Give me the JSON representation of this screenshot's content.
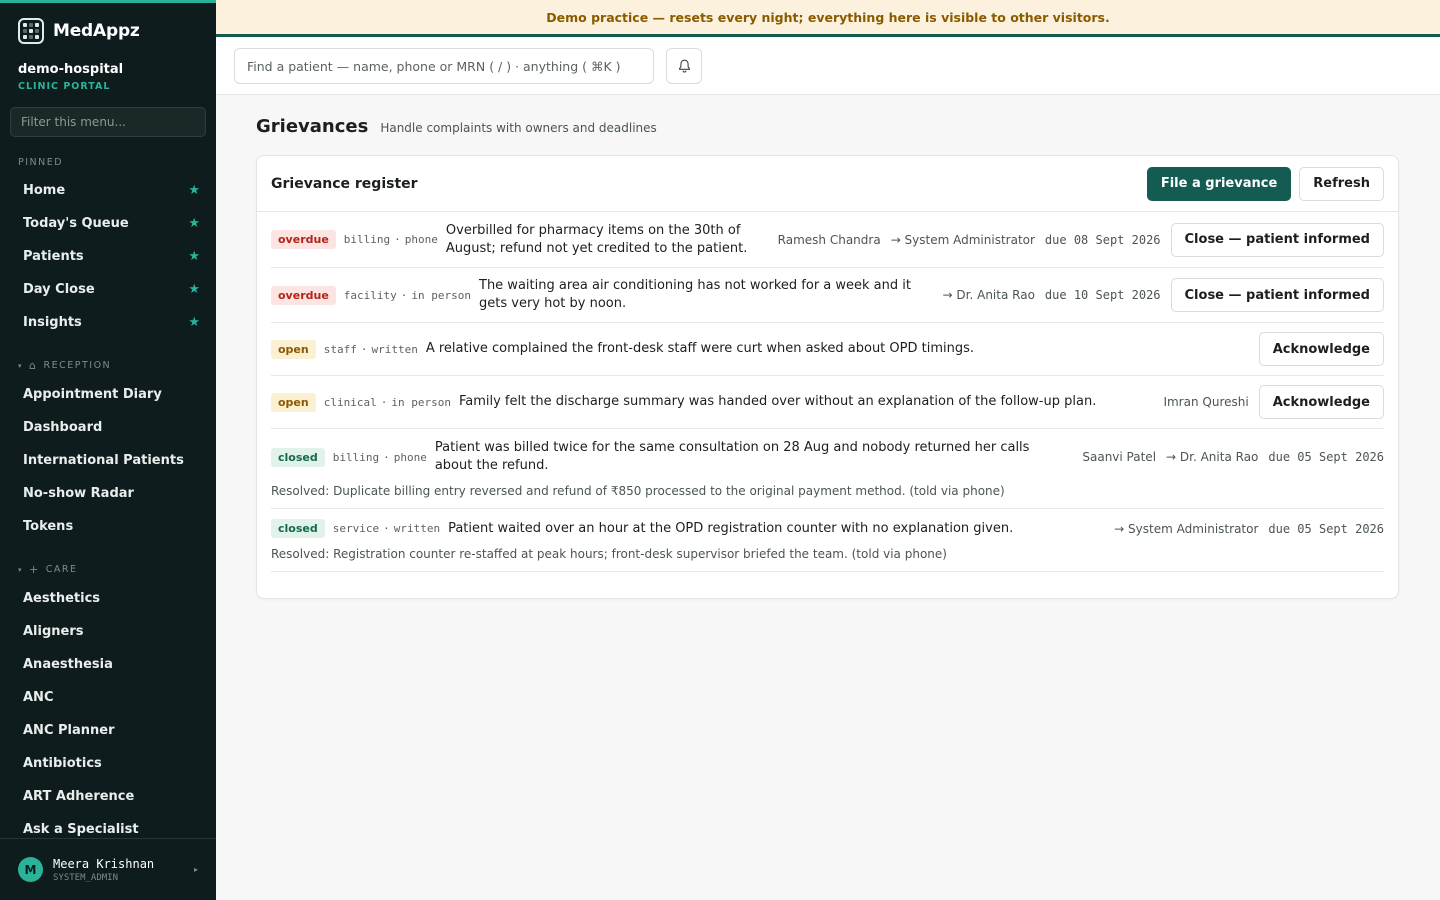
{
  "app": {
    "brand": "MedAppz",
    "org_name": "demo-hospital",
    "org_sub": "CLINIC PORTAL",
    "menu_filter_placeholder": "Filter this menu..."
  },
  "banner": "Demo practice — resets every night; everything here is visible to other visitors.",
  "topbar": {
    "search_placeholder": "Find a patient — name, phone or MRN ( / ) · anything ( ⌘K )"
  },
  "sidebar": {
    "pinned_label": "PINNED",
    "pinned": [
      {
        "label": "Home"
      },
      {
        "label": "Today's Queue"
      },
      {
        "label": "Patients"
      },
      {
        "label": "Day Close"
      },
      {
        "label": "Insights"
      }
    ],
    "reception_label": "RECEPTION",
    "reception": [
      {
        "label": "Appointment Diary"
      },
      {
        "label": "Dashboard"
      },
      {
        "label": "International Patients"
      },
      {
        "label": "No-show Radar"
      },
      {
        "label": "Tokens"
      }
    ],
    "care_label": "CARE",
    "care": [
      {
        "label": "Aesthetics"
      },
      {
        "label": "Aligners"
      },
      {
        "label": "Anaesthesia"
      },
      {
        "label": "ANC"
      },
      {
        "label": "ANC Planner"
      },
      {
        "label": "Antibiotics"
      },
      {
        "label": "ART Adherence"
      },
      {
        "label": "Ask a Specialist"
      }
    ]
  },
  "user": {
    "initial": "M",
    "name": "Meera Krishnan",
    "role": "SYSTEM_ADMIN"
  },
  "page": {
    "title": "Grievances",
    "subtitle": "Handle complaints with owners and deadlines"
  },
  "register": {
    "title": "Grievance register",
    "file_button": "File a grievance",
    "refresh_button": "Refresh",
    "rows": [
      {
        "status": "overdue",
        "category": "billing",
        "channel": "phone",
        "description": "Overbilled for pharmacy items on the 30th of August; refund not yet credited to the patient.",
        "person": "Ramesh Chandra",
        "owner": "→ System Administrator",
        "due": "due 08 Sept 2026",
        "action": "Close — patient informed",
        "resolution": ""
      },
      {
        "status": "overdue",
        "category": "facility",
        "channel": "in person",
        "description": "The waiting area air conditioning has not worked for a week and it gets very hot by noon.",
        "person": "",
        "owner": "→ Dr. Anita Rao",
        "due": "due 10 Sept 2026",
        "action": "Close — patient informed",
        "resolution": ""
      },
      {
        "status": "open",
        "category": "staff",
        "channel": "written",
        "description": "A relative complained the front-desk staff were curt when asked about OPD timings.",
        "person": "",
        "owner": "",
        "due": "",
        "action": "Acknowledge",
        "resolution": ""
      },
      {
        "status": "open",
        "category": "clinical",
        "channel": "in person",
        "description": "Family felt the discharge summary was handed over without an explanation of the follow-up plan.",
        "person": "Imran Qureshi",
        "owner": "",
        "due": "",
        "action": "Acknowledge",
        "resolution": ""
      },
      {
        "status": "closed",
        "category": "billing",
        "channel": "phone",
        "description": "Patient was billed twice for the same consultation on 28 Aug and nobody returned her calls about the refund.",
        "person": "Saanvi Patel",
        "owner": "→ Dr. Anita Rao",
        "due": "due 05 Sept 2026",
        "action": "",
        "resolution": "Resolved: Duplicate billing entry reversed and refund of ₹850 processed to the original payment method. (told via phone)"
      },
      {
        "status": "closed",
        "category": "service",
        "channel": "written",
        "description": "Patient waited over an hour at the OPD registration counter with no explanation given.",
        "person": "",
        "owner": "→ System Administrator",
        "due": "due 05 Sept 2026",
        "action": "",
        "resolution": "Resolved: Registration counter re-staffed at peak hours; front-desk supervisor briefed the team. (told via phone)"
      }
    ]
  }
}
